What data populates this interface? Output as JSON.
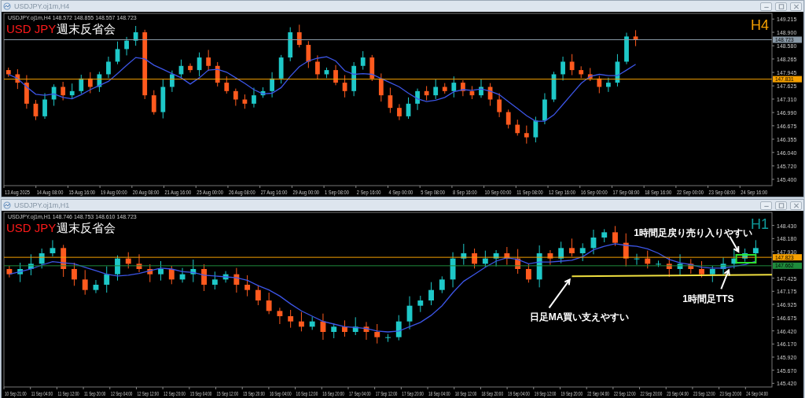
{
  "windows": [
    {
      "title": "USDJPY.oj1m,H4",
      "info": "USDJPY.oj1m,H4  148.572 148.855 148.557 148.723",
      "symbol": "USD JPY",
      "caption": "週末反省会",
      "timeframe": "H4",
      "price_labels": [
        "149.215",
        "148.900",
        "148.580",
        "148.265",
        "147.945",
        "147.625",
        "147.310",
        "146.990",
        "146.675",
        "146.355",
        "146.040",
        "145.720",
        "145.400"
      ],
      "price_tags": [
        {
          "label": "148.723",
          "color": "#8a9aa8"
        },
        {
          "label": "147.831",
          "color": "#f5a000"
        }
      ],
      "time_labels": [
        "13 Aug 2025",
        "14 Aug 08:00",
        "15 Aug 16:00",
        "19 Aug 00:00",
        "20 Aug 08:00",
        "21 Aug 16:00",
        "25 Aug 00:00",
        "26 Aug 08:00",
        "27 Aug 16:00",
        "29 Aug 00:00",
        "1 Sep 08:00",
        "2 Sep 16:00",
        "4 Sep 00:00",
        "5 Sep 08:00",
        "8 Sep 16:00",
        "10 Sep 00:00",
        "11 Sep 08:00",
        "12 Sep 16:00",
        "16 Sep 00:00",
        "17 Sep 08:00",
        "18 Sep 16:00",
        "22 Sep 00:00",
        "23 Sep 08:00",
        "24 Sep 16:00"
      ]
    },
    {
      "title": "USDJPY.oj1m,H1",
      "info": "USDJPY.oj1m,H1  148.746 148.753 148.610 148.723",
      "symbol": "USD JPY",
      "caption": "週末反省会",
      "timeframe": "H1",
      "price_labels": [
        "148.430",
        "148.180",
        "147.930",
        "147.425",
        "147.175",
        "146.925",
        "146.675",
        "146.420",
        "146.170",
        "145.920",
        "145.670",
        "145.420"
      ],
      "price_tags": [
        {
          "label": "147.823",
          "color": "#f5a000"
        },
        {
          "label": "147.662",
          "color": "#1e8c3c"
        }
      ],
      "time_labels": [
        "10 Sep 21:00",
        "11 Sep 04:00",
        "11 Sep 12:00",
        "11 Sep 20:00",
        "12 Sep 04:00",
        "12 Sep 12:00",
        "12 Sep 20:00",
        "15 Sep 04:00",
        "15 Sep 12:00",
        "15 Sep 20:00",
        "16 Sep 04:00",
        "16 Sep 12:00",
        "16 Sep 20:00",
        "17 Sep 04:00",
        "17 Sep 12:00",
        "17 Sep 20:00",
        "18 Sep 04:00",
        "18 Sep 12:00",
        "18 Sep 20:00",
        "19 Sep 04:00",
        "19 Sep 12:00",
        "19 Sep 20:00",
        "22 Sep 04:00",
        "22 Sep 12:00",
        "22 Sep 20:00",
        "23 Sep 04:00",
        "23 Sep 12:00",
        "23 Sep 20:00",
        "24 Sep 04:00"
      ],
      "annotations": [
        {
          "text": "1時間足戻り売り入りやすい"
        },
        {
          "text": "1時間足TTS"
        },
        {
          "text": "日足MA買い支えやすい"
        }
      ]
    }
  ]
}
